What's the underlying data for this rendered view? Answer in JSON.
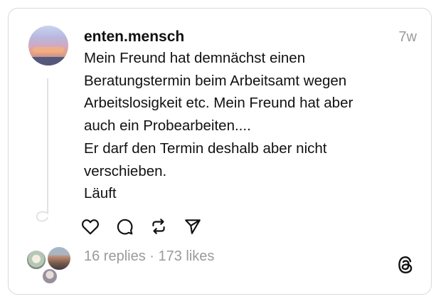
{
  "post": {
    "username": "enten.mensch",
    "time": "7w",
    "lines": [
      "Mein Freund hat demnächst einen",
      "Beratungstermin beim Arbeitsamt wegen",
      "Arbeitslosigkeit etc. Mein Freund hat aber",
      "auch ein Probearbeiten....",
      "Er darf den Termin deshalb aber nicht",
      "verschieben.",
      "Läuft"
    ],
    "stats": "16 replies · 173 likes"
  },
  "icons": {
    "like": "heart-icon",
    "reply": "comment-icon",
    "repost": "repost-icon",
    "share": "send-icon",
    "brand": "threads-logo-icon"
  },
  "colors": {
    "text": "#111111",
    "muted": "#9a9a9a",
    "border": "#d9d9d9"
  }
}
